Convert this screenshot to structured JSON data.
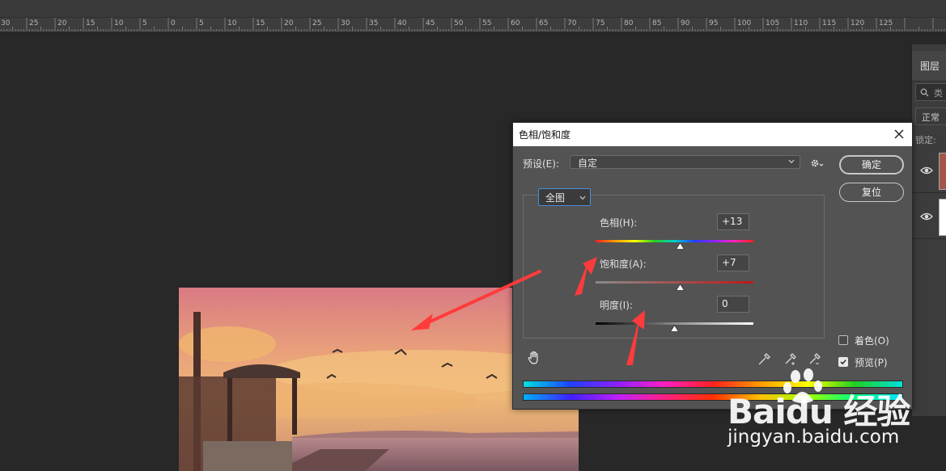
{
  "ruler": {
    "labels": [
      "30",
      "25",
      "20",
      "15",
      "10",
      "5",
      "0",
      "5",
      "10",
      "15",
      "20",
      "25",
      "30",
      "35",
      "40",
      "45",
      "50",
      "55",
      "60",
      "65",
      "70",
      "75",
      "80",
      "85",
      "90",
      "95",
      "100",
      "105",
      "110",
      "115",
      "120",
      "125"
    ]
  },
  "layers_panel": {
    "tab_label": "图层",
    "search_placeholder": "类",
    "blend_mode": "正常",
    "lock_label": "锁定:"
  },
  "dialog": {
    "title": "色相/饱和度",
    "preset_label": "预设(E):",
    "preset_value": "自定",
    "ok_label": "确定",
    "reset_label": "复位",
    "channel_value": "全图",
    "hue": {
      "label": "色相(H):",
      "value": "+13",
      "level_fraction": 0.5361
    },
    "saturation": {
      "label": "饱和度(A):",
      "value": "+7",
      "level_fraction": 0.535
    },
    "lightness": {
      "label": "明度(I):",
      "value": "0",
      "level_fraction": 0.5
    },
    "colorize_label": "着色(O)",
    "colorize_checked": false,
    "preview_label": "预览(P)",
    "preview_checked": true
  },
  "watermark": {
    "brand": "Baidu 经验",
    "url": "jingyan.baidu.com"
  },
  "colors": {
    "annotation_arrow": "#ff3b3b",
    "dialog_bg": "#535353",
    "app_bg": "#282828"
  }
}
